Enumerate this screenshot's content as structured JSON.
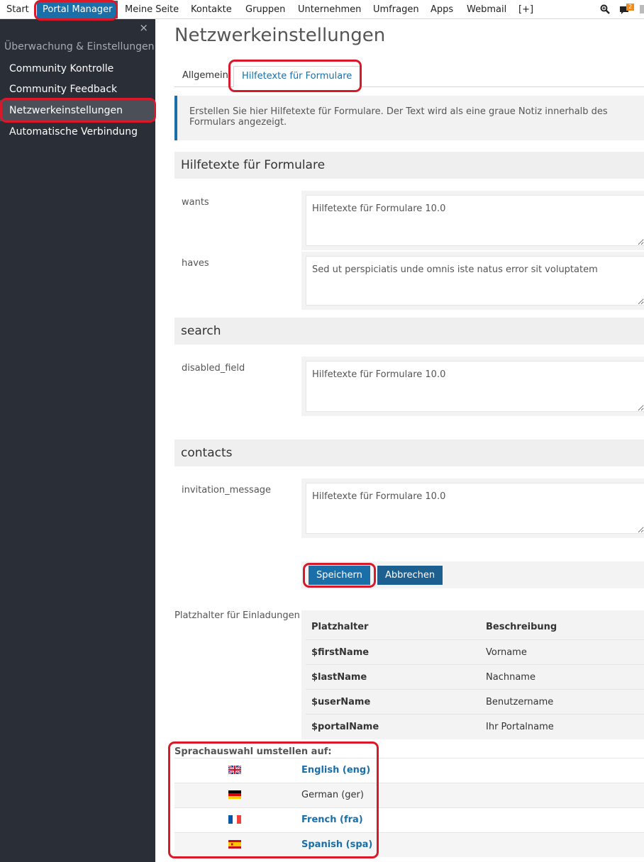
{
  "topnav": {
    "items": [
      "Start",
      "Portal Manager",
      "Meine Seite",
      "Kontakte",
      "Gruppen",
      "Unternehmen",
      "Umfragen",
      "Apps",
      "Webmail",
      "[+]"
    ],
    "active": "Portal Manager",
    "notification_count": "2"
  },
  "sidebar": {
    "close": "×",
    "heading": "Überwachung & Einstellungen",
    "items": [
      "Community Kontrolle",
      "Community Feedback",
      "Netzwerkeinstellungen",
      "Automatische Verbindung"
    ],
    "active": "Netzwerkeinstellungen"
  },
  "main": {
    "title": "Netzwerkeinstellungen",
    "tabs": [
      "Allgemein",
      "Hilfetexte für Formulare"
    ],
    "active_tab": "Hilfetexte für Formulare",
    "info": "Erstellen Sie hier Hilfetexte für Formulare. Der Text wird als eine graue Notiz innerhalb des Formulars angezeigt.",
    "sections": [
      {
        "title": "Hilfetexte für Formulare",
        "fields": [
          {
            "label": "wants",
            "value": "Hilfetexte für Formulare 10.0"
          },
          {
            "label": "haves",
            "value": "Sed ut perspiciatis unde omnis iste natus error sit voluptatem"
          }
        ]
      },
      {
        "title": "search",
        "fields": [
          {
            "label": "disabled_field",
            "value": "Hilfetexte für Formulare 10.0"
          }
        ]
      },
      {
        "title": "contacts",
        "fields": [
          {
            "label": "invitation_message",
            "value": "Hilfetexte für Formulare 10.0"
          }
        ]
      }
    ],
    "buttons": {
      "save": "Speichern",
      "cancel": "Abbrechen"
    },
    "placeholders": {
      "label": "Platzhalter für Einladungen",
      "headers": [
        "Platzhalter",
        "Beschreibung"
      ],
      "rows": [
        [
          "$firstName",
          "Vorname"
        ],
        [
          "$lastName",
          "Nachname"
        ],
        [
          "$userName",
          "Benutzername"
        ],
        [
          "$portalName",
          "Ihr Portalname"
        ]
      ]
    },
    "language": {
      "heading": "Sprachauswahl umstellen auf:",
      "options": [
        {
          "name": "English (eng)",
          "flag": "uk-flag-icon",
          "current": false
        },
        {
          "name": "German (ger)",
          "flag": "germany-flag-icon",
          "current": true
        },
        {
          "name": "French (fra)",
          "flag": "france-flag-icon",
          "current": false
        },
        {
          "name": "Spanish (spa)",
          "flag": "spain-flag-icon",
          "current": false
        }
      ]
    }
  },
  "colors": {
    "accent": "#1a6fa8",
    "sidebar_bg": "#2a2e36",
    "highlight": "#d9182a",
    "notification": "#f08c1e"
  }
}
